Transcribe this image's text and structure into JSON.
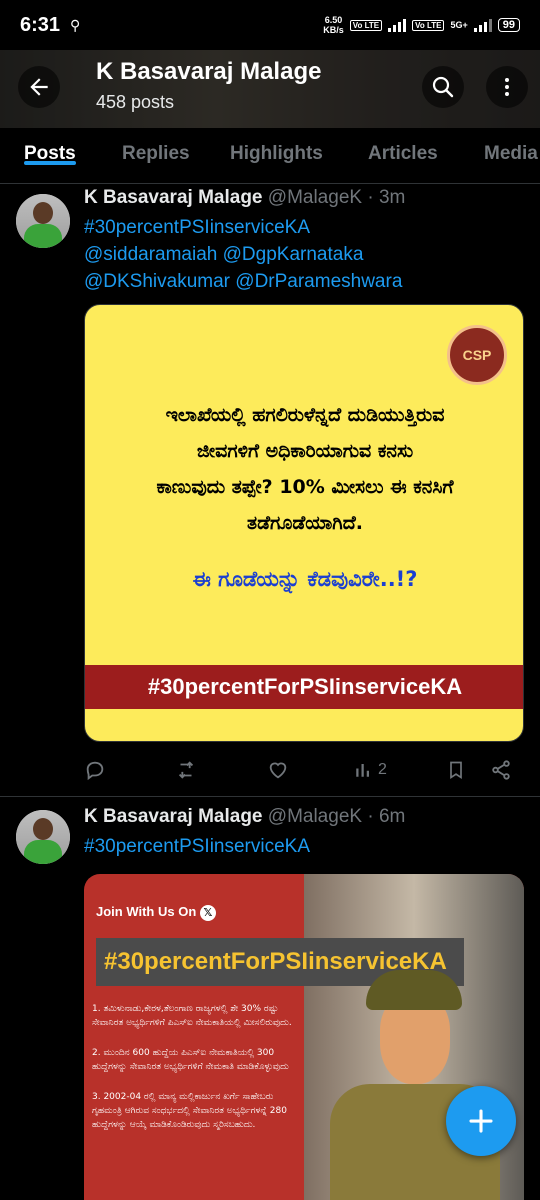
{
  "status_bar": {
    "time": "6:31",
    "speed_value": "6.50",
    "speed_unit": "KB/s",
    "vo_lte_1": "Vo LTE",
    "vo_lte_2": "Vo LTE",
    "network": "5G+",
    "battery": "99"
  },
  "header": {
    "name": "K Basavaraj Malage",
    "posts_count": "458 posts"
  },
  "tabs": [
    "Posts",
    "Replies",
    "Highlights",
    "Articles",
    "Media"
  ],
  "tweets": [
    {
      "name": "K Basavaraj Malage",
      "handle": "@MalageK",
      "time": "· 3m",
      "lines": [
        "#30percentPSIinserviceKA",
        "@siddaramaiah @DgpKarnataka",
        "@DKShivakumar @DrParameshwara"
      ],
      "image": {
        "logo_text": "CSP",
        "kannada_lines": [
          "ಇಲಾಖೆಯಲ್ಲಿ ಹಗಲಿರುಳೆನ್ನದೆ ದುಡಿಯುತ್ತಿರುವ",
          "ಜೀವಗಳಿಗೆ ಅಧಿಕಾರಿಯಾಗುವ ಕನಸು",
          "ಕಾಣುವುದು ತಪ್ಪೇ? 10% ಮೀಸಲು ಈ ಕನಸಿಗೆ",
          "ತಡೆಗೂಡೆಯಾಗಿದೆ."
        ],
        "kannada_question": "ಈ ಗೂಡೆಯನ್ನು ಕೆಡವುವಿರೇ..!?",
        "banner": "#30percentForPSIinserviceKA"
      },
      "views": "2"
    },
    {
      "name": "K Basavaraj Malage",
      "handle": "@MalageK",
      "time": "· 6m",
      "lines": [
        "#30percentPSIinserviceKA"
      ],
      "image": {
        "join_text": "Join With Us On",
        "tag": "#30percentForPSIinserviceKA",
        "points": [
          "1. ತಮಿಳುನಾಡು,ಕೇರಳ,ತೆಲಂಗಾಣ ರಾಜ್ಯಗಳಲ್ಲಿ ಶೇ 30% ರಷ್ಟು ಸೇವಾನಿರತ ಅಭ್ಯರ್ಥಿಗಳಿಗೆ ಪಿಎಸ್ಐ ನೇಮಕಾತಿಯಲ್ಲಿ ಮೀಸಲಿರುವುದು.",
          "2. ಮುಂದಿನ 600 ಹುದ್ದೆಯ ಪಿಎಸ್ಐ ನೇಮಕಾತಿಯಲ್ಲಿ 300 ಹುದ್ದೆಗಳನ್ನು ಸೇವಾನಿರತ ಅಭ್ಯರ್ಥಿಗಳಿಗೆ ನೇಮಕಾತಿ ಮಾಡಿಕೊಳ್ಳುವುದು",
          "3. 2002-04 ರಲ್ಲಿ ಮಾನ್ಯ ಮಲ್ಲಿಕಾರ್ಜುನ ಖರ್ಗೆ ಸಾಹೇಬರು ಗೃಹಮಂತ್ರಿ ಆಗಿರುವ ಸಂಧರ್ಭದಲ್ಲಿ ಸೇವಾನಿರತ ಅಭ್ಯರ್ಥಿಗಳನ್ನೆ 280 ಹುದ್ದೆಗಳನ್ನು ಆಯ್ಕೆ ಮಾಡಿಕೊಂಡಿರುವುದು ಸ್ಮರಿಸಬಹುದು."
        ]
      }
    }
  ],
  "colors": {
    "accent": "#1d9bf0",
    "background": "#000000",
    "muted": "#71767b"
  }
}
